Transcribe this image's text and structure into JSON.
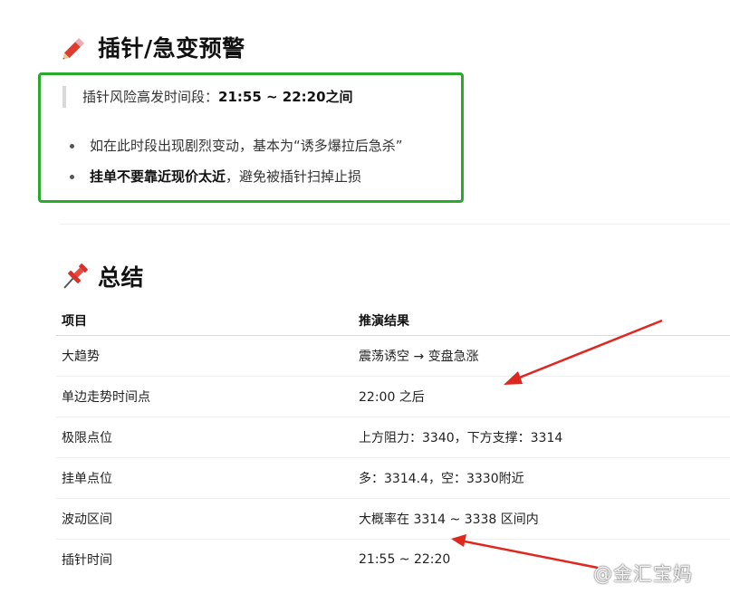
{
  "warning": {
    "title": "插针/急变预警",
    "icon": "pencil-icon",
    "quote_prefix": "插针风险高发时间段：",
    "quote_time": "21:55 ~ 22:20之间",
    "bullet1": "如在此时段出现剧烈变动，基本为“诱多爆拉后急杀”",
    "bullet2_bold": "挂单不要靠近现价太近",
    "bullet2_rest": "，避免被插针扫掉止损"
  },
  "summary": {
    "title": "总结",
    "icon": "pushpin-icon",
    "headers": [
      "项目",
      "推演结果"
    ],
    "rows": [
      [
        "大趋势",
        "震荡诱空 → 变盘急涨"
      ],
      [
        "单边走势时间点",
        "22:00 之后"
      ],
      [
        "极限点位",
        "上方阻力：3340，下方支撑：3314"
      ],
      [
        "挂单点位",
        "多：3314.4，空：3330附近"
      ],
      [
        "波动区间",
        "大概率在 3314 ~ 3338 区间内"
      ],
      [
        "插针时间",
        "21:55 ~ 22:20"
      ]
    ]
  },
  "watermark": "@金汇宝妈",
  "colors": {
    "alert_border": "#2aaa2a",
    "arrow": "#e0261d"
  }
}
